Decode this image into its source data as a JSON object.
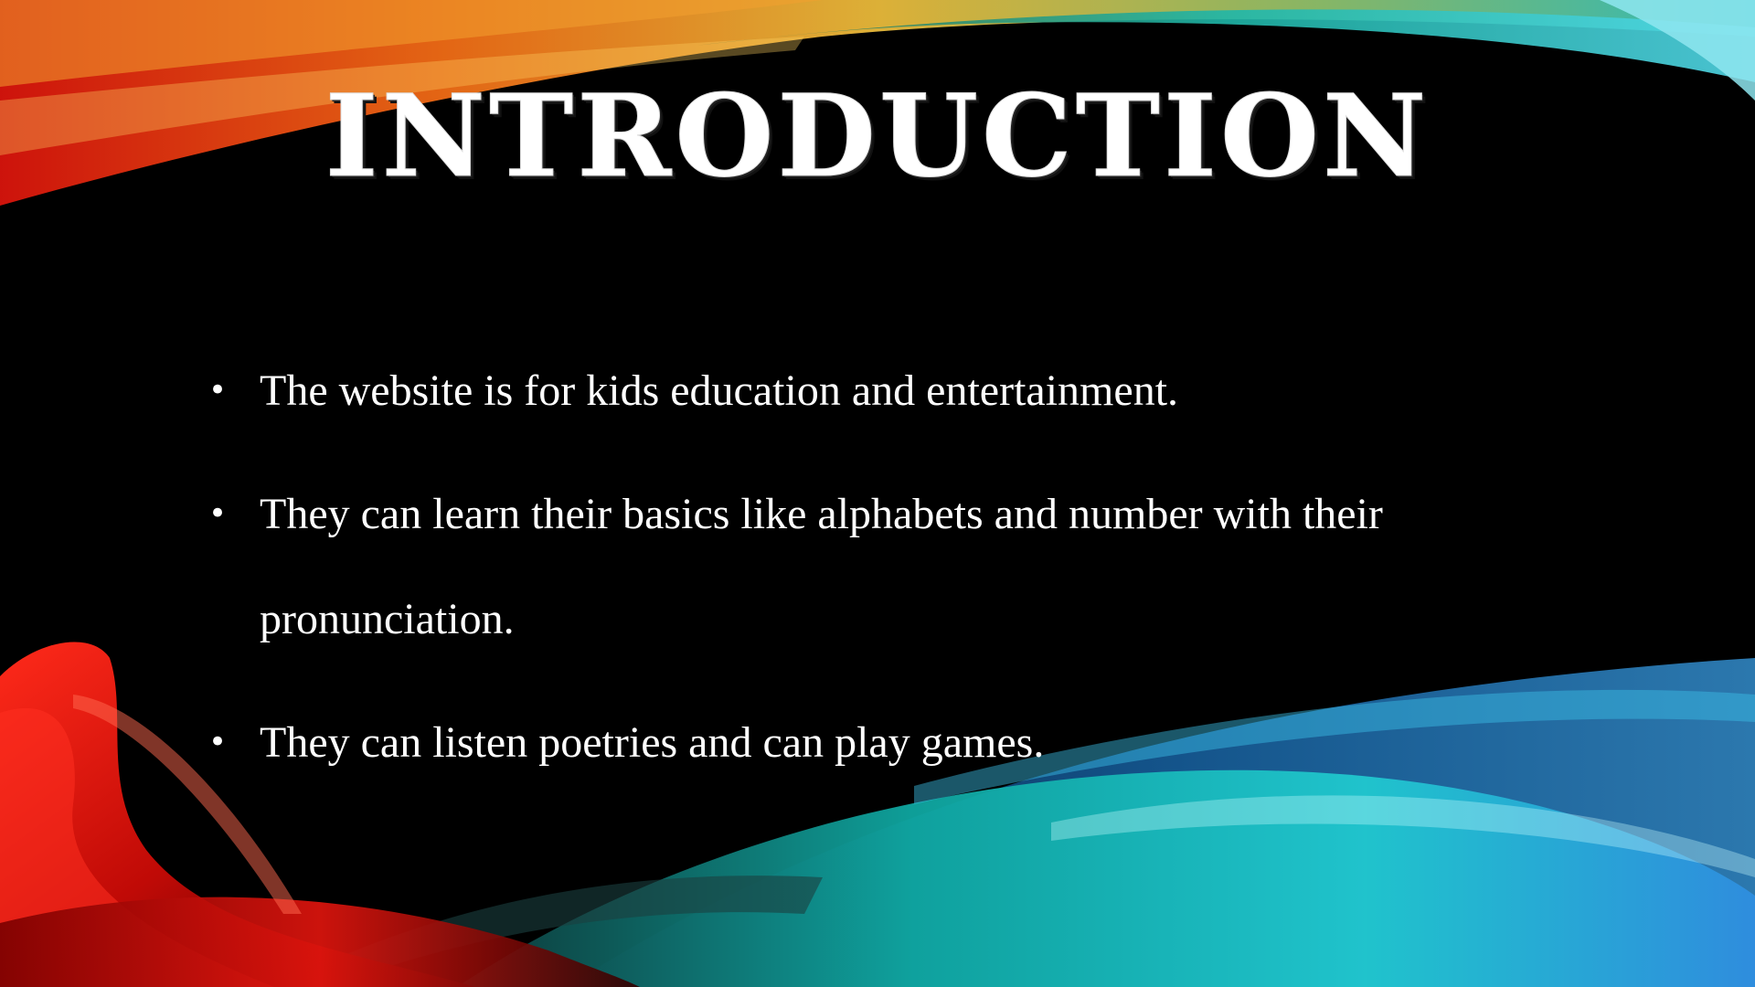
{
  "slide": {
    "title": "Introduction",
    "bullets": [
      {
        "text": "The website is for kids education and entertainment."
      },
      {
        "text": "They can learn their basics like alphabets and number with their pronunciation."
      },
      {
        "text": "They can listen poetries and can play games."
      }
    ],
    "bullet_symbol": "•"
  },
  "colors": {
    "background": "#000000",
    "text": "#ffffff",
    "ribbon_red": "#e0110f",
    "ribbon_orange": "#f07a1a",
    "ribbon_yellow": "#e6c23a",
    "ribbon_teal": "#1fc8c8",
    "ribbon_blue": "#2a8fd8"
  }
}
